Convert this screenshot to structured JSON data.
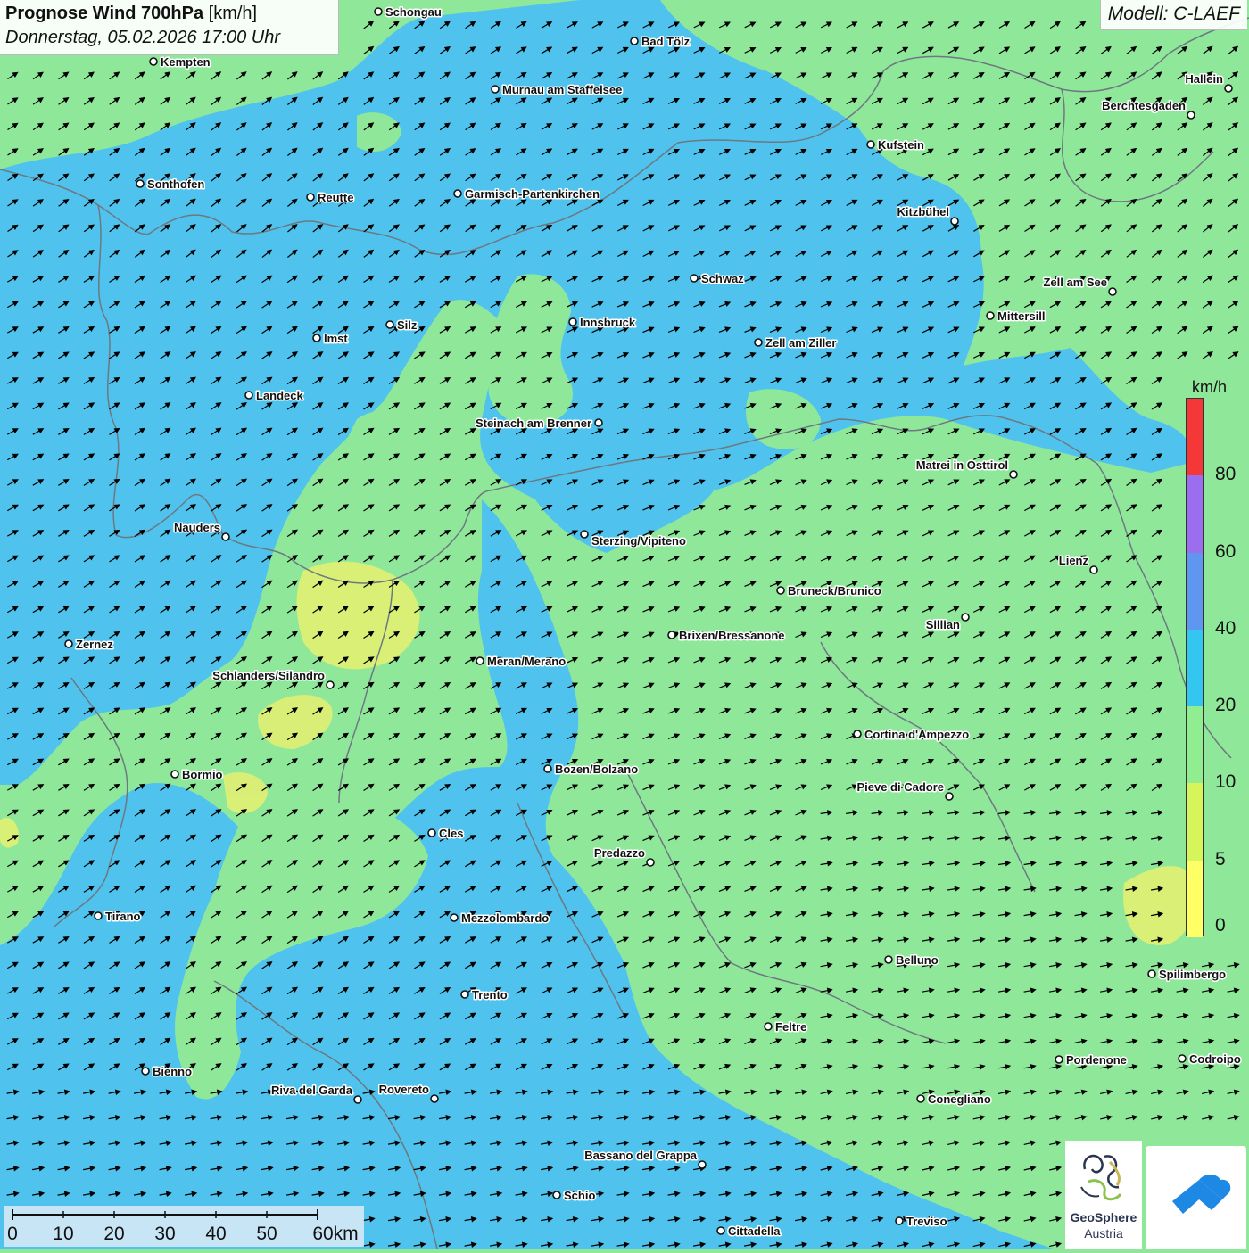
{
  "header": {
    "title_bold": "Prognose Wind 700hPa",
    "title_unit": "[km/h]",
    "datetime": "Donnerstag, 05.02.2026 17:00 Uhr",
    "model": "Modell: C-LAEF"
  },
  "colors": {
    "land_blue": "#4fc3ee",
    "land_green": "#8fe89a",
    "land_yellow": "#e6f070",
    "border_line": "#6d7880"
  },
  "legend": {
    "unit": "km/h",
    "segments": [
      {
        "from": 0,
        "to": 5,
        "color": "#ffff66"
      },
      {
        "from": 5,
        "to": 10,
        "color": "#d6f55a"
      },
      {
        "from": 10,
        "to": 20,
        "color": "#90ee90"
      },
      {
        "from": 20,
        "to": 40,
        "color": "#33c6f0"
      },
      {
        "from": 40,
        "to": 60,
        "color": "#5f96f0"
      },
      {
        "from": 60,
        "to": 80,
        "color": "#9b6ef0"
      },
      {
        "from": 80,
        "to": 100,
        "color": "#f43737"
      }
    ],
    "ticks": [
      "0",
      "5",
      "10",
      "20",
      "40",
      "60",
      "80"
    ]
  },
  "scalebar": {
    "labels": [
      "0",
      "10",
      "20",
      "30",
      "40",
      "50",
      "60km"
    ]
  },
  "cities": [
    {
      "name": "Schongau"
    },
    {
      "name": "Kempten"
    },
    {
      "name": "Bad Tölz"
    },
    {
      "name": "Murnau am Staffelsee"
    },
    {
      "name": "Hallein"
    },
    {
      "name": "Berchtesgaden"
    },
    {
      "name": "Kufstein"
    },
    {
      "name": "Sonthofen"
    },
    {
      "name": "Reutte"
    },
    {
      "name": "Garmisch-Partenkirchen"
    },
    {
      "name": "Kitzbühel"
    },
    {
      "name": "Schwaz"
    },
    {
      "name": "Zell am See"
    },
    {
      "name": "Mittersill"
    },
    {
      "name": "Innsbruck"
    },
    {
      "name": "Silz"
    },
    {
      "name": "Imst"
    },
    {
      "name": "Zell am Ziller"
    },
    {
      "name": "Landeck"
    },
    {
      "name": "Steinach am Brenner"
    },
    {
      "name": "Matrei in Osttirol"
    },
    {
      "name": "Nauders"
    },
    {
      "name": "Sterzing/Vipiteno"
    },
    {
      "name": "Lienz"
    },
    {
      "name": "Bruneck/Brunico"
    },
    {
      "name": "Sillian"
    },
    {
      "name": "Zernez"
    },
    {
      "name": "Brixen/Bressanone"
    },
    {
      "name": "Meran/Merano"
    },
    {
      "name": "Schlanders/Silandro"
    },
    {
      "name": "Cortina d'Ampezzo"
    },
    {
      "name": "Bozen/Bolzano"
    },
    {
      "name": "Bormio"
    },
    {
      "name": "Pieve di Cadore"
    },
    {
      "name": "Cles"
    },
    {
      "name": "Predazzo"
    },
    {
      "name": "Tirano"
    },
    {
      "name": "Mezzolombardo"
    },
    {
      "name": "Belluno"
    },
    {
      "name": "Spilimbergo"
    },
    {
      "name": "Trento"
    },
    {
      "name": "Feltre"
    },
    {
      "name": "Bienno"
    },
    {
      "name": "Pordenone"
    },
    {
      "name": "Codroipo"
    },
    {
      "name": "Riva del Garda"
    },
    {
      "name": "Rovereto"
    },
    {
      "name": "Conegliano"
    },
    {
      "name": "Bassano del Grappa"
    },
    {
      "name": "Schio"
    },
    {
      "name": "Treviso"
    },
    {
      "name": "Cittadella"
    }
  ],
  "logos": {
    "geosphere_line1": "GeoSphere",
    "geosphere_line2": "Austria"
  }
}
